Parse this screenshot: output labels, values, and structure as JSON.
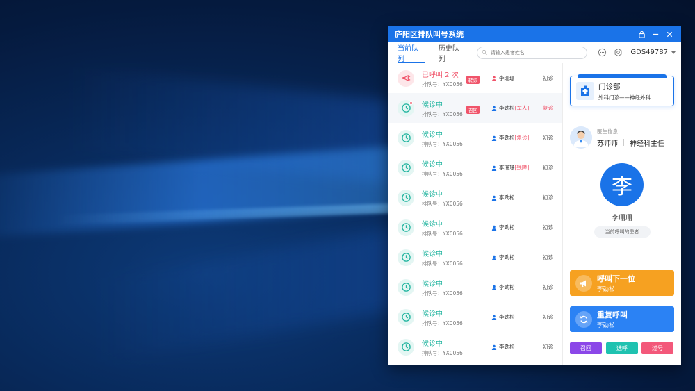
{
  "window": {
    "title": "庐阳区排队叫号系统"
  },
  "toolbar": {
    "tabs": [
      {
        "label": "当前队列",
        "active": true
      },
      {
        "label": "历史队列",
        "active": false
      }
    ],
    "search_placeholder": "请输入患者姓名",
    "user": "GDS49787"
  },
  "queue": [
    {
      "status": "已呼叫 2 次",
      "kind": "called",
      "number": "排队号：YX0056",
      "tag": "转诊",
      "patient": "李珊珊",
      "note": "",
      "visit": "初诊",
      "selected": false,
      "dot": false
    },
    {
      "status": "候诊中",
      "kind": "wait",
      "number": "排队号：YX0056",
      "tag": "召回",
      "patient": "李劲松",
      "note": "[军人]",
      "visit": "复诊",
      "selected": true,
      "dot": true
    },
    {
      "status": "候诊中",
      "kind": "wait",
      "number": "排队号：YX0056",
      "tag": "",
      "patient": "李劲松",
      "note": "[急诊]",
      "visit": "初诊",
      "selected": false,
      "dot": false
    },
    {
      "status": "候诊中",
      "kind": "wait",
      "number": "排队号：YX0056",
      "tag": "",
      "patient": "李珊珊",
      "note": "[残障]",
      "visit": "初诊",
      "selected": false,
      "dot": false
    },
    {
      "status": "候诊中",
      "kind": "wait",
      "number": "排队号：YX0056",
      "tag": "",
      "patient": "李劲松",
      "note": "",
      "visit": "初诊",
      "selected": false,
      "dot": false
    },
    {
      "status": "候诊中",
      "kind": "wait",
      "number": "排队号：YX0056",
      "tag": "",
      "patient": "李劲松",
      "note": "",
      "visit": "初诊",
      "selected": false,
      "dot": false
    },
    {
      "status": "候诊中",
      "kind": "wait",
      "number": "排队号：YX0056",
      "tag": "",
      "patient": "李劲松",
      "note": "",
      "visit": "初诊",
      "selected": false,
      "dot": false
    },
    {
      "status": "候诊中",
      "kind": "wait",
      "number": "排队号：YX0056",
      "tag": "",
      "patient": "李劲松",
      "note": "",
      "visit": "初诊",
      "selected": false,
      "dot": false
    },
    {
      "status": "候诊中",
      "kind": "wait",
      "number": "排队号：YX0056",
      "tag": "",
      "patient": "李劲松",
      "note": "",
      "visit": "初诊",
      "selected": false,
      "dot": false
    },
    {
      "status": "候诊中",
      "kind": "wait",
      "number": "排队号：YX0056",
      "tag": "",
      "patient": "李劲松",
      "note": "",
      "visit": "初诊",
      "selected": false,
      "dot": false
    }
  ],
  "department": {
    "name": "门诊部",
    "sub": "外科门诊——神经外科"
  },
  "doctor": {
    "label": "医生信息",
    "name": "苏师师",
    "title": "神经科主任"
  },
  "current_patient": {
    "avatar_char": "李",
    "name": "李珊珊",
    "label": "当前呼叫的患者"
  },
  "actions": {
    "next_title": "呼叫下一位",
    "next_patient": "李劲松",
    "repeat_title": "重复呼叫",
    "repeat_patient": "李劲松",
    "recall": "召回",
    "select": "选呼",
    "skip": "过号"
  },
  "colors": {
    "primary": "#1a73e8",
    "waiting": "#23b5a0",
    "called": "#f0546a",
    "next_button": "#f6a121",
    "recall_button": "#8b47e8",
    "select_button": "#1fc2b0",
    "skip_button": "#f3587a"
  }
}
